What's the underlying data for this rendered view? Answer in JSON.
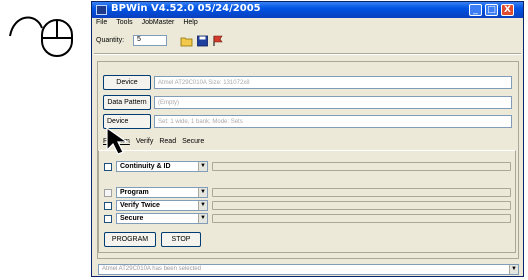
{
  "window": {
    "title": "BPWin  V4.52.0  05/24/2005",
    "minimize_glyph": "_",
    "maximize_glyph": "□",
    "close_glyph": "X"
  },
  "menu": [
    "File",
    "Tools",
    "JobMaster",
    "Help"
  ],
  "toolbar": {
    "quantity_label": "Quantity:",
    "quantity_value": "5",
    "icons": [
      "open-folder-icon",
      "save-disk-icon",
      "flag-icon"
    ]
  },
  "device_panel": {
    "device_button": "Device",
    "device_info": "Atmel AT29C010A   Size: 131072x8",
    "data_pattern_button": "Data Pattern",
    "data_pattern_info": "(Empty)",
    "device_settings_button": "Device",
    "device_settings_info": "Set: 1 wide, 1 bank;   Mode: Sets"
  },
  "tabs": [
    "Program",
    "Verify",
    "Read",
    "Secure"
  ],
  "operations": [
    {
      "label": "Continuity & ID",
      "checked": false
    },
    {
      "label": "Program",
      "checked": false
    },
    {
      "label": "Verify Twice",
      "checked": false
    },
    {
      "label": "Secure",
      "checked": false
    }
  ],
  "action_buttons": {
    "program": "PROGRAM",
    "stop": "STOP"
  },
  "status_bar": {
    "text": "Atmel AT29C010A has been selected"
  },
  "colors": {
    "titlebar": "#0054e3",
    "window_bg": "#ece9d8",
    "close_button": "#e04a2e"
  }
}
